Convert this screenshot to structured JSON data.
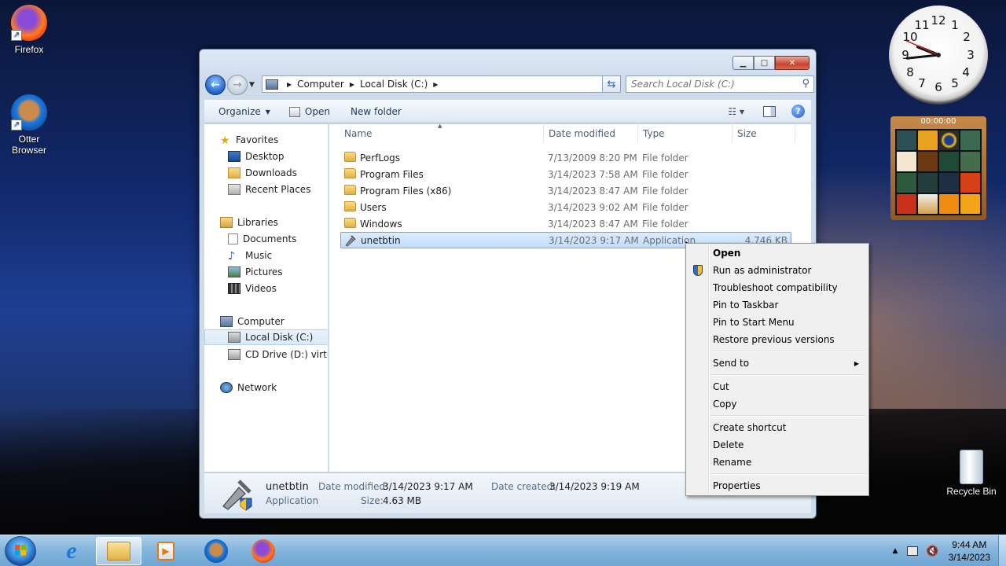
{
  "desktop": {
    "icons": [
      {
        "label": "Firefox",
        "icon": "firefox-icon"
      },
      {
        "label": "Otter\nBrowser",
        "icon": "otter-browser-icon"
      },
      {
        "label": "Recycle Bin",
        "icon": "recycle-bin-icon"
      }
    ],
    "gadgets": {
      "clock": {
        "hour": 9,
        "minute": 44,
        "second": 49
      },
      "puzzle": {
        "timer": "00:00:00"
      }
    }
  },
  "window": {
    "address": [
      "Computer",
      "Local Disk (C:)"
    ],
    "search_placeholder": "Search Local Disk (C:)",
    "toolbar": {
      "organize": "Organize",
      "open": "Open",
      "new_folder": "New folder"
    },
    "nav": {
      "favorites": "Favorites",
      "desktop": "Desktop",
      "downloads": "Downloads",
      "recent": "Recent Places",
      "libraries": "Libraries",
      "documents": "Documents",
      "music": "Music",
      "pictures": "Pictures",
      "videos": "Videos",
      "computer": "Computer",
      "local_disk": "Local Disk (C:)",
      "cd_drive": "CD Drive (D:) virtio-w",
      "network": "Network"
    },
    "columns": {
      "name": "Name",
      "date": "Date modified",
      "type": "Type",
      "size": "Size"
    },
    "files": [
      {
        "name": "PerfLogs",
        "date": "7/13/2009 8:20 PM",
        "type": "File folder",
        "size": ""
      },
      {
        "name": "Program Files",
        "date": "3/14/2023 7:58 AM",
        "type": "File folder",
        "size": ""
      },
      {
        "name": "Program Files (x86)",
        "date": "3/14/2023 8:47 AM",
        "type": "File folder",
        "size": ""
      },
      {
        "name": "Users",
        "date": "3/14/2023 9:02 AM",
        "type": "File folder",
        "size": ""
      },
      {
        "name": "Windows",
        "date": "3/14/2023 8:47 AM",
        "type": "File folder",
        "size": ""
      },
      {
        "name": "unetbtin",
        "date": "3/14/2023 9:17 AM",
        "type": "Application",
        "size": "4,746 KB"
      }
    ],
    "details": {
      "name": "unetbtin",
      "type": "Application",
      "date_modified_label": "Date modified:",
      "date_modified": "3/14/2023 9:17 AM",
      "date_created_label": "Date created:",
      "date_created": "3/14/2023 9:19 AM",
      "size_label": "Size:",
      "size": "4.63 MB"
    }
  },
  "context_menu": {
    "items": [
      "Open",
      "Run as administrator",
      "Troubleshoot compatibility",
      "Pin to Taskbar",
      "Pin to Start Menu",
      "Restore previous versions",
      "Send to",
      "Cut",
      "Copy",
      "Create shortcut",
      "Delete",
      "Rename",
      "Properties"
    ]
  },
  "taskbar": {
    "apps": [
      "internet-explorer-icon",
      "windows-explorer-icon",
      "media-player-icon",
      "otter-browser-icon",
      "firefox-icon"
    ],
    "time": "9:44 AM",
    "date": "3/14/2023"
  },
  "colors": {
    "accent": "#2161c7",
    "selection": "#c2dcfa",
    "taskbar": "#86b6dc"
  }
}
